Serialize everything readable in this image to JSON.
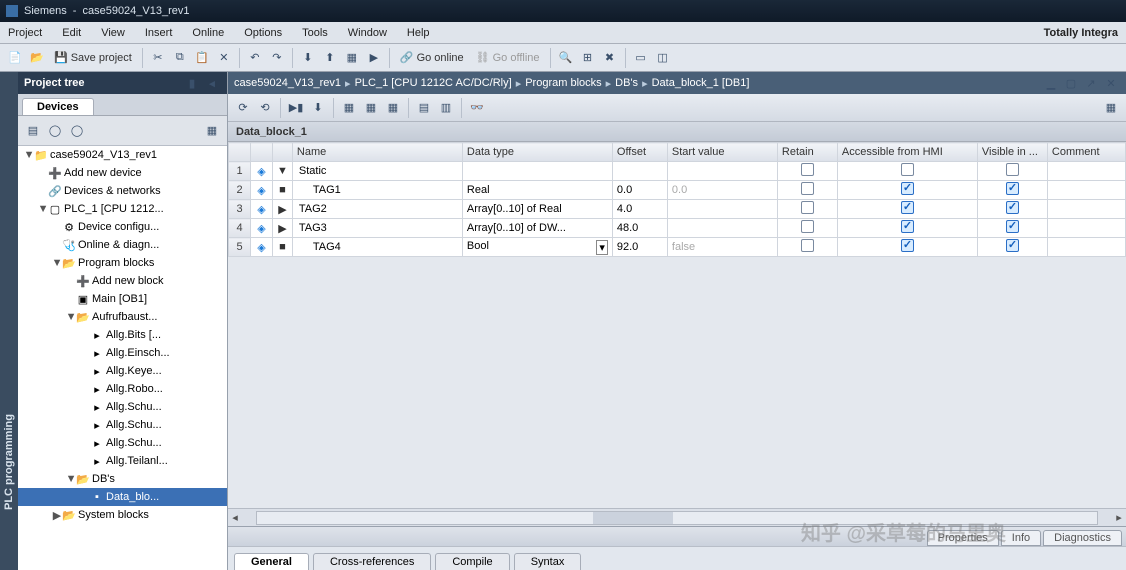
{
  "window": {
    "app": "Siemens",
    "dash": " - ",
    "title": "case59024_V13_rev1"
  },
  "menu": [
    "Project",
    "Edit",
    "View",
    "Insert",
    "Online",
    "Options",
    "Tools",
    "Window",
    "Help"
  ],
  "brand": "Totally Integra",
  "toolbar": {
    "save": "Save project",
    "goonline": "Go online",
    "gooffline": "Go offline"
  },
  "tree_header": "Project tree",
  "devices_tab": "Devices",
  "tree": [
    {
      "ind": 0,
      "exp": "▼",
      "icon": "proj",
      "label": "case59024_V13_rev1"
    },
    {
      "ind": 1,
      "exp": "",
      "icon": "add",
      "label": "Add new device"
    },
    {
      "ind": 1,
      "exp": "",
      "icon": "net",
      "label": "Devices & networks"
    },
    {
      "ind": 1,
      "exp": "▼",
      "icon": "plc",
      "label": "PLC_1 [CPU 1212..."
    },
    {
      "ind": 2,
      "exp": "",
      "icon": "cfg",
      "label": "Device configu..."
    },
    {
      "ind": 2,
      "exp": "",
      "icon": "diag",
      "label": "Online & diagn..."
    },
    {
      "ind": 2,
      "exp": "▼",
      "icon": "fld",
      "label": "Program blocks"
    },
    {
      "ind": 3,
      "exp": "",
      "icon": "add",
      "label": "Add new block"
    },
    {
      "ind": 3,
      "exp": "",
      "icon": "ob",
      "label": "Main [OB1]"
    },
    {
      "ind": 3,
      "exp": "▼",
      "icon": "fld",
      "label": "Aufrufbaust..."
    },
    {
      "ind": 4,
      "exp": "",
      "icon": "fc",
      "label": "Allg.Bits [..."
    },
    {
      "ind": 4,
      "exp": "",
      "icon": "fc",
      "label": "Allg.Einsch..."
    },
    {
      "ind": 4,
      "exp": "",
      "icon": "fc",
      "label": "Allg.Keye..."
    },
    {
      "ind": 4,
      "exp": "",
      "icon": "fc",
      "label": "Allg.Robo..."
    },
    {
      "ind": 4,
      "exp": "",
      "icon": "fc",
      "label": "Allg.Schu..."
    },
    {
      "ind": 4,
      "exp": "",
      "icon": "fc",
      "label": "Allg.Schu..."
    },
    {
      "ind": 4,
      "exp": "",
      "icon": "fc",
      "label": "Allg.Schu..."
    },
    {
      "ind": 4,
      "exp": "",
      "icon": "fc",
      "label": "Allg.Teilanl..."
    },
    {
      "ind": 3,
      "exp": "▼",
      "icon": "fld",
      "label": "DB's"
    },
    {
      "ind": 4,
      "exp": "",
      "icon": "db",
      "label": "Data_blo...",
      "sel": true
    },
    {
      "ind": 2,
      "exp": "▶",
      "icon": "fld",
      "label": "System blocks"
    }
  ],
  "breadcrumb": [
    "case59024_V13_rev1",
    "PLC_1 [CPU 1212C AC/DC/Rly]",
    "Program blocks",
    "DB's",
    "Data_block_1 [DB1]"
  ],
  "block_title": "Data_block_1",
  "columns": [
    "",
    "",
    "",
    "Name",
    "Data type",
    "Offset",
    "Start value",
    "Retain",
    "Accessible from HMI",
    "Visible in ...",
    "Comment"
  ],
  "rows": [
    {
      "n": "1",
      "exp": "▼",
      "name": "Static",
      "type": "",
      "off": "",
      "start": "",
      "ret": "u",
      "acc": "u",
      "vis": "u"
    },
    {
      "n": "2",
      "exp": "",
      "name": "TAG1",
      "type": "Real",
      "off": "0.0",
      "start": "0.0",
      "startph": true,
      "ret": "u",
      "acc": "c",
      "vis": "c"
    },
    {
      "n": "3",
      "exp": "▶",
      "name": "TAG2",
      "type": "Array[0..10] of Real",
      "off": "4.0",
      "start": "",
      "ret": "u",
      "acc": "c",
      "vis": "c"
    },
    {
      "n": "4",
      "exp": "▶",
      "name": "TAG3",
      "type": "Array[0..10] of DW...",
      "off": "48.0",
      "start": "",
      "ret": "u",
      "acc": "c",
      "vis": "c"
    },
    {
      "n": "5",
      "exp": "",
      "name": "TAG4",
      "type": "Bool",
      "dd": true,
      "off": "92.0",
      "start": "false",
      "startph": true,
      "ret": "u",
      "acc": "c",
      "vis": "c"
    }
  ],
  "props_tabs": [
    "Properties",
    "Info",
    "Diagnostics"
  ],
  "lower_tabs": [
    "General",
    "Cross-references",
    "Compile",
    "Syntax"
  ],
  "side_label": "PLC programming",
  "watermark": "知乎 @采草莓的马里奥"
}
